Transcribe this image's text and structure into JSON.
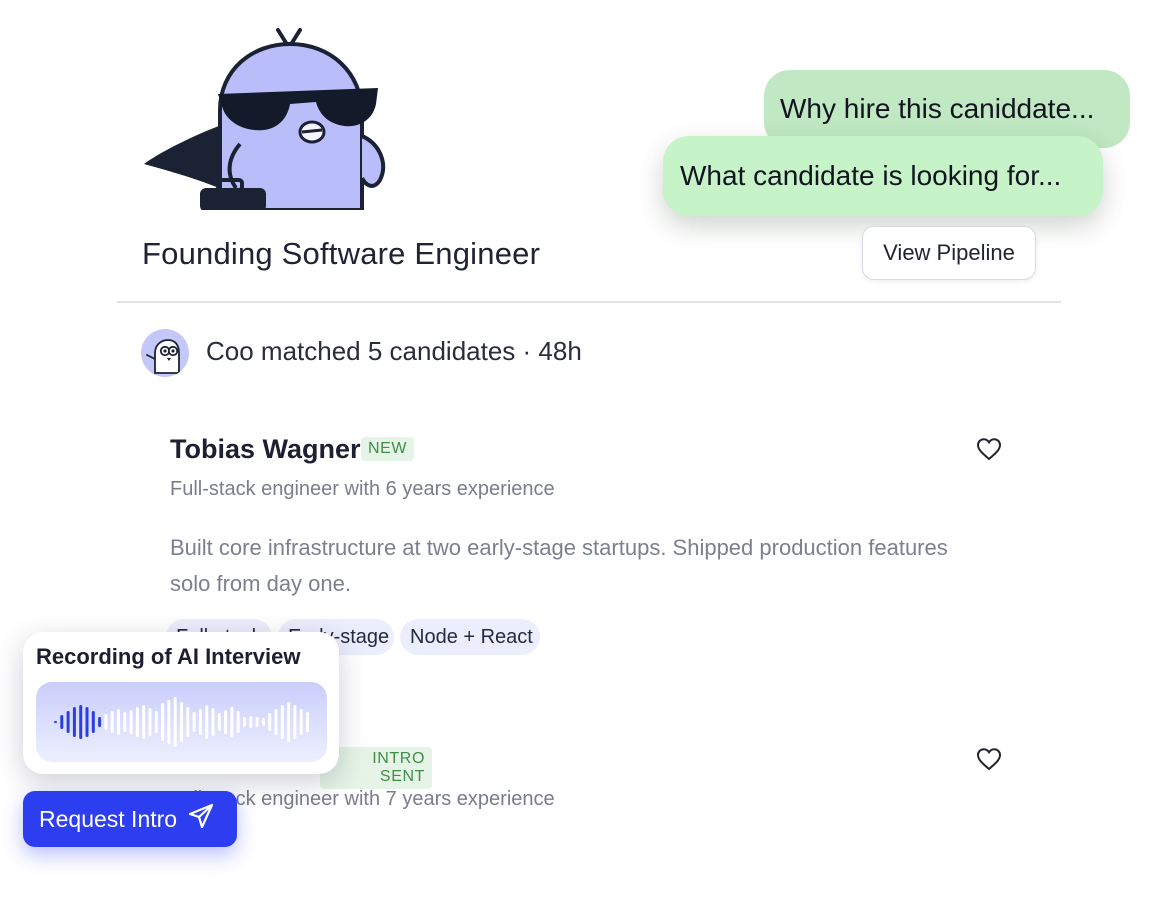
{
  "chat": {
    "bubble_1": "Why hire this caniddate...",
    "bubble_2": "What candidate is looking for..."
  },
  "job": {
    "title": "Founding Software Engineer",
    "view_pipeline_label": "View Pipeline"
  },
  "match": {
    "text": "Coo matched 5 candidates · 48h"
  },
  "candidates": [
    {
      "name": "Tobias Wagner",
      "badge": "NEW",
      "subtitle": "Full-stack engineer with 6 years experience",
      "summary": "Built core infrastructure at two early-stage startups. Shipped production features solo from day one.",
      "tags": [
        "Full-stack",
        "Early-stage",
        "Node + React"
      ],
      "favorite_icon": "heart-outline-icon"
    },
    {
      "badge": "INTRO SENT",
      "subtitle": "Full-stack engineer with 7 years experience",
      "favorite_icon": "heart-outline-icon"
    }
  ],
  "recording": {
    "title": "Recording of AI Interview"
  },
  "request_intro": {
    "label": "Request Intro",
    "icon": "send-icon"
  },
  "colors": {
    "accent": "#2d3ef0",
    "bubble_green": "#c6f3c7",
    "badge_green_text": "#3f8e48",
    "tag_bg": "#eceefd",
    "mascot_body": "#b9befa"
  }
}
